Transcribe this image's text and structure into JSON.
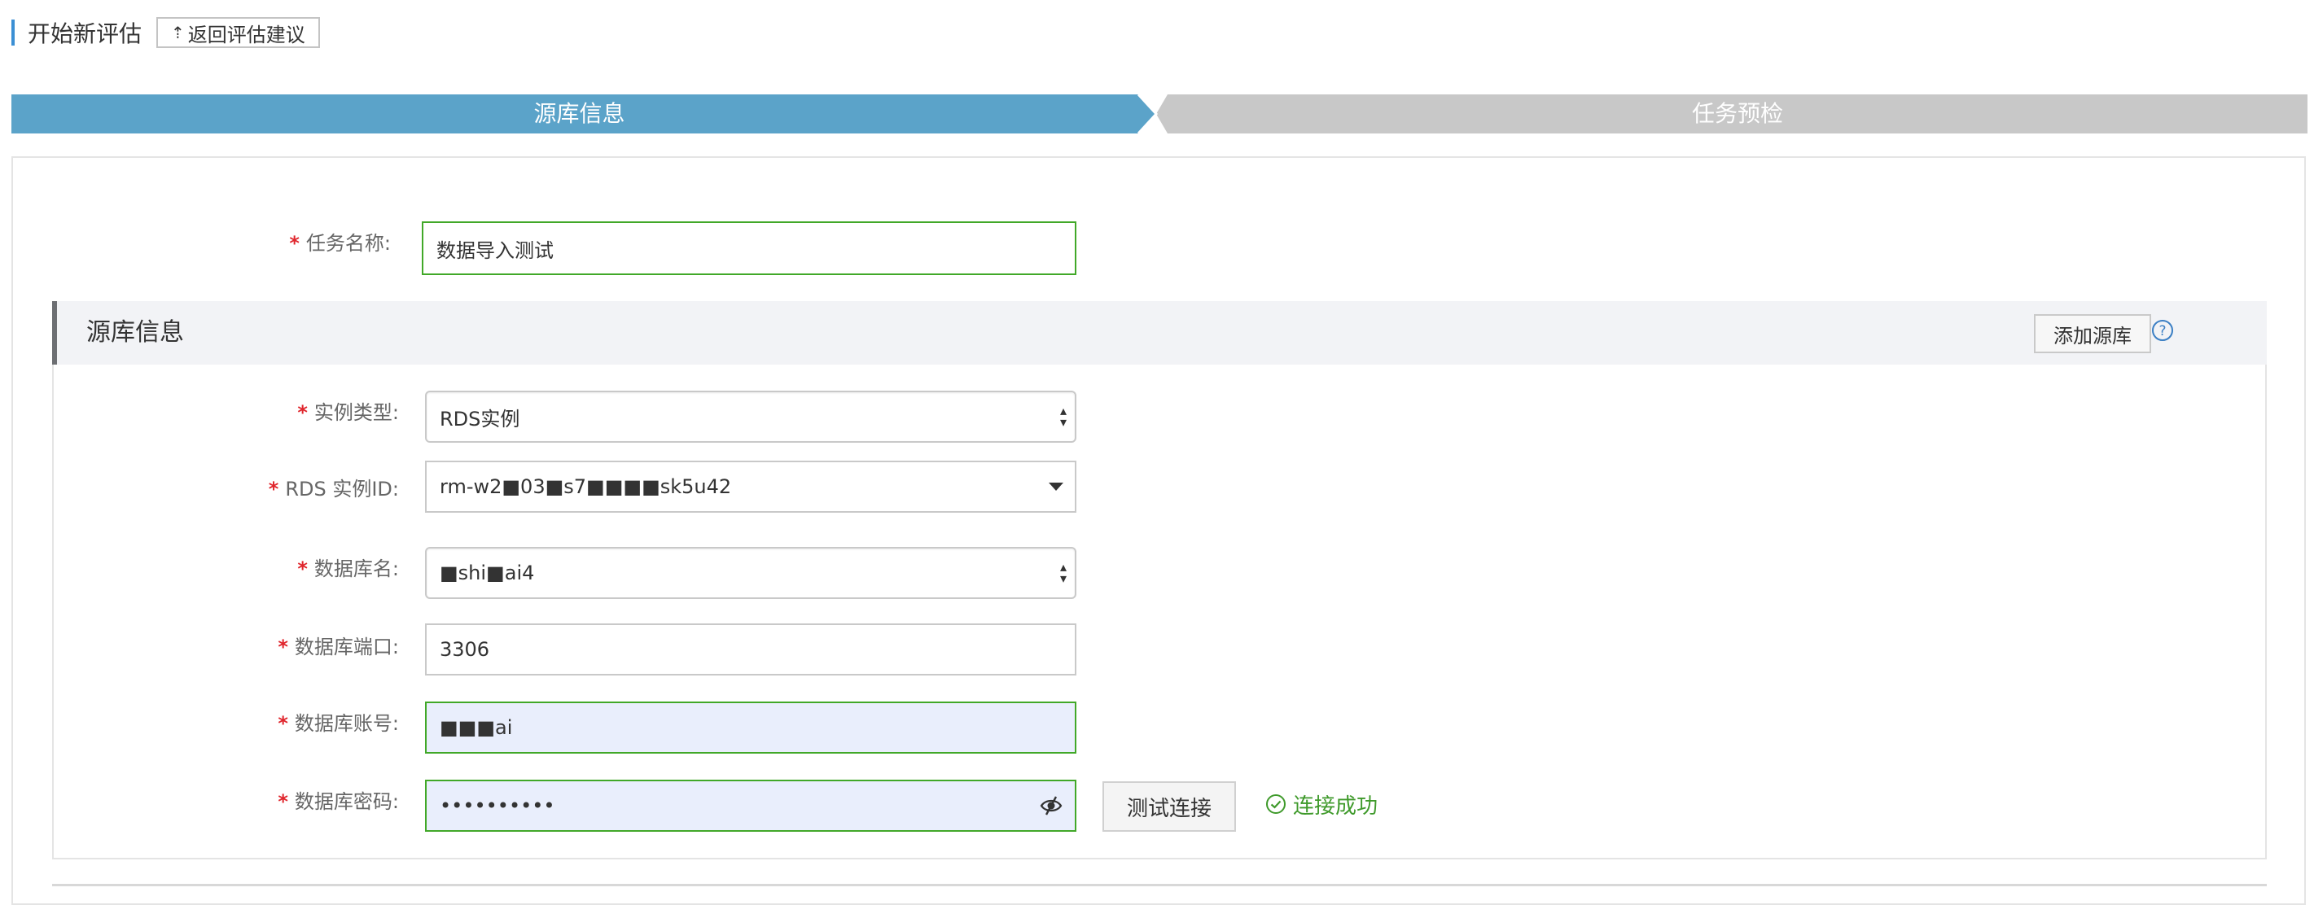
{
  "header": {
    "title": "开始新评估",
    "back_button": "返回评估建议",
    "back_icon": "upload-arrow"
  },
  "steps": [
    {
      "label": "源库信息",
      "state": "active",
      "color": "#5ba3c9"
    },
    {
      "label": "任务预检",
      "state": "inactive",
      "color": "#c8c8c8"
    }
  ],
  "form": {
    "task_name": {
      "label": "任务名称:",
      "value": "数据导入测试"
    },
    "source_section": {
      "title": "源库信息",
      "add_button": "添加源库",
      "help_icon": "question-circle",
      "fields": {
        "instance_type": {
          "label": "实例类型:",
          "value": "RDS实例"
        },
        "rds_instance_id": {
          "label": "RDS 实例ID:",
          "value": "rm-w2■03■s7■■■■sk5u42"
        },
        "database_name": {
          "label": "数据库名:",
          "value": "■shi■ai4"
        },
        "database_port": {
          "label": "数据库端口:",
          "value": "3306"
        },
        "database_account": {
          "label": "数据库账号:",
          "value": "■■■ai"
        },
        "database_password": {
          "label": "数据库密码:",
          "value": "••••••••••"
        }
      },
      "test_button": "测试连接",
      "status": {
        "text": "连接成功",
        "color": "#3f9a2b"
      }
    }
  },
  "required_mark": "*"
}
